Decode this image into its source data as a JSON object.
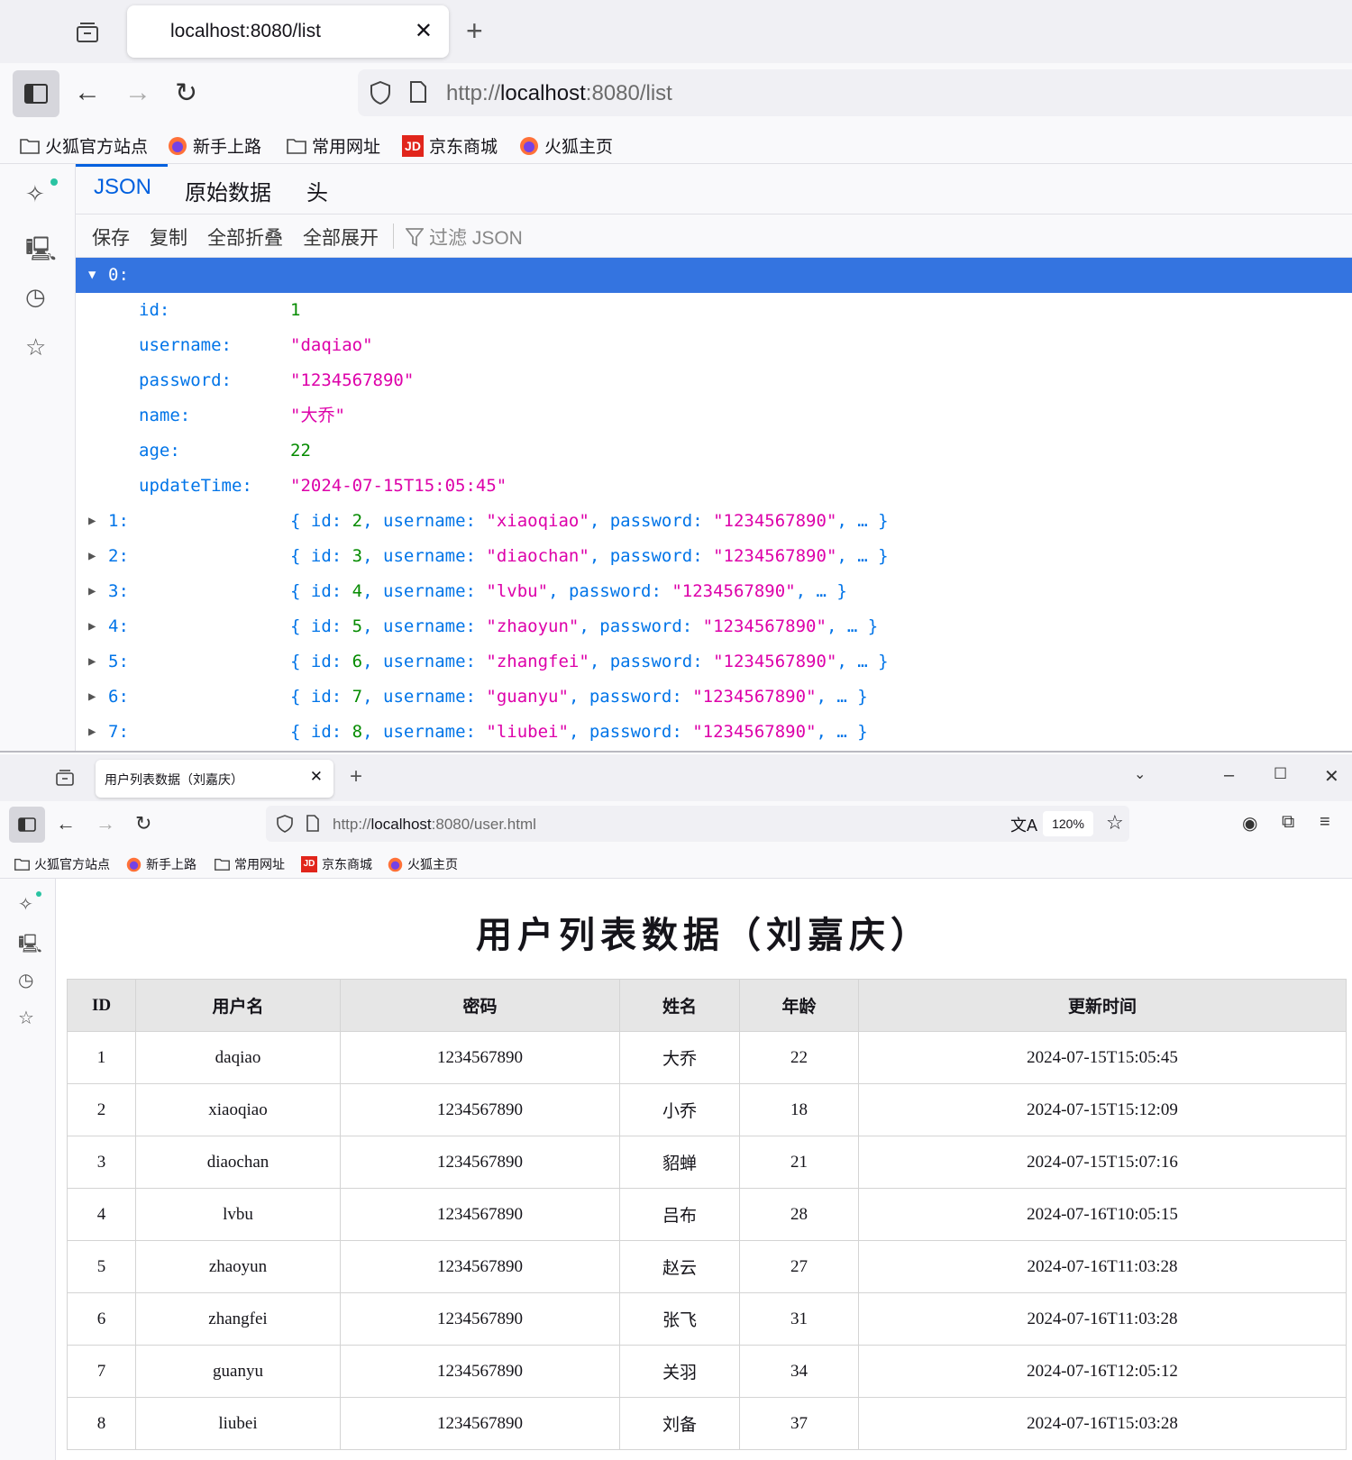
{
  "window1": {
    "tab_title": "localhost:8080/list",
    "url_prefix": "http://",
    "url_host": "localhost",
    "url_rest": ":8080/list",
    "bookmarks": [
      "火狐官方站点",
      "新手上路",
      "常用网址",
      "京东商城",
      "火狐主页"
    ],
    "viewer_tabs": [
      "JSON",
      "原始数据",
      "头"
    ],
    "toolbar": {
      "save": "保存",
      "copy": "复制",
      "collapse_all": "全部折叠",
      "expand_all": "全部展开",
      "filter": "过滤 JSON"
    },
    "expanded": {
      "key": "0:",
      "fields": [
        {
          "key": "id:",
          "value": "1",
          "type": "num"
        },
        {
          "key": "username:",
          "value": "\"daqiao\"",
          "type": "str"
        },
        {
          "key": "password:",
          "value": "\"1234567890\"",
          "type": "str"
        },
        {
          "key": "name:",
          "value": "\"大乔\"",
          "type": "str"
        },
        {
          "key": "age:",
          "value": "22",
          "type": "num"
        },
        {
          "key": "updateTime:",
          "value": "\"2024-07-15T15:05:45\"",
          "type": "str"
        }
      ]
    },
    "collapsed": [
      {
        "key": "1:",
        "id": "2",
        "username": "\"xiaoqiao\"",
        "password": "\"1234567890\""
      },
      {
        "key": "2:",
        "id": "3",
        "username": "\"diaochan\"",
        "password": "\"1234567890\""
      },
      {
        "key": "3:",
        "id": "4",
        "username": "\"lvbu\"",
        "password": "\"1234567890\""
      },
      {
        "key": "4:",
        "id": "5",
        "username": "\"zhaoyun\"",
        "password": "\"1234567890\""
      },
      {
        "key": "5:",
        "id": "6",
        "username": "\"zhangfei\"",
        "password": "\"1234567890\""
      },
      {
        "key": "6:",
        "id": "7",
        "username": "\"guanyu\"",
        "password": "\"1234567890\""
      },
      {
        "key": "7:",
        "id": "8",
        "username": "\"liubei\"",
        "password": "\"1234567890\""
      }
    ]
  },
  "window2": {
    "tab_title": "用户列表数据（刘嘉庆）",
    "url_prefix": "http://",
    "url_host": "localhost",
    "url_rest": ":8080/user.html",
    "zoom": "120%",
    "bookmarks": [
      "火狐官方站点",
      "新手上路",
      "常用网址",
      "京东商城",
      "火狐主页"
    ],
    "page_title": "用户列表数据（刘嘉庆）",
    "table": {
      "headers": [
        "ID",
        "用户名",
        "密码",
        "姓名",
        "年龄",
        "更新时间"
      ],
      "rows": [
        [
          "1",
          "daqiao",
          "1234567890",
          "大乔",
          "22",
          "2024-07-15T15:05:45"
        ],
        [
          "2",
          "xiaoqiao",
          "1234567890",
          "小乔",
          "18",
          "2024-07-15T15:12:09"
        ],
        [
          "3",
          "diaochan",
          "1234567890",
          "貂蝉",
          "21",
          "2024-07-15T15:07:16"
        ],
        [
          "4",
          "lvbu",
          "1234567890",
          "吕布",
          "28",
          "2024-07-16T10:05:15"
        ],
        [
          "5",
          "zhaoyun",
          "1234567890",
          "赵云",
          "27",
          "2024-07-16T11:03:28"
        ],
        [
          "6",
          "zhangfei",
          "1234567890",
          "张飞",
          "31",
          "2024-07-16T11:03:28"
        ],
        [
          "7",
          "guanyu",
          "1234567890",
          "关羽",
          "34",
          "2024-07-16T12:05:12"
        ],
        [
          "8",
          "liubei",
          "1234567890",
          "刘备",
          "37",
          "2024-07-16T15:03:28"
        ]
      ]
    }
  },
  "colors": {
    "accent": "#0060df",
    "selected_row": "#3474e0",
    "json_key": "#0074e8",
    "json_string": "#dd00a9",
    "json_number": "#058b00"
  }
}
